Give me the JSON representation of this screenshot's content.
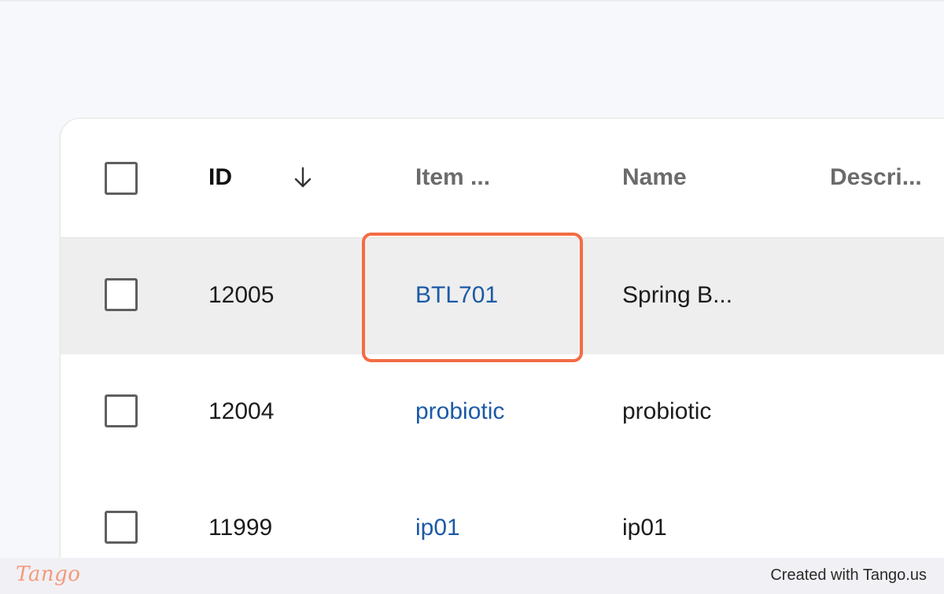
{
  "table": {
    "headers": {
      "id": "ID",
      "item": "Item ...",
      "name": "Name",
      "description": "Descri..."
    },
    "sort": {
      "column": "ID",
      "direction": "descending",
      "icon": "arrow-down-icon"
    },
    "rows": [
      {
        "id": "12005",
        "item": "BTL701",
        "name": "Spring B...",
        "highlighted": true
      },
      {
        "id": "12004",
        "item": "probiotic",
        "name": "probiotic"
      },
      {
        "id": "11999",
        "item": "ip01",
        "name": "ip01"
      }
    ]
  },
  "colors": {
    "accent_highlight": "#f26c43",
    "link": "#1c5aa6",
    "hover_row": "#eeeeee"
  },
  "footer": {
    "logo": "Tango",
    "credit": "Created with Tango.us"
  }
}
